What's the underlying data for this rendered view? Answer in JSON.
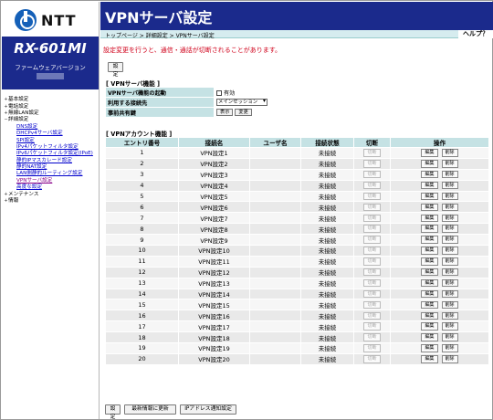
{
  "sidebar": {
    "logo_text": "NTT",
    "model": "RX-601MI",
    "firmware_label": "ファームウェアバージョン",
    "nav": [
      {
        "label": "基本設定",
        "level": 0,
        "toggle": "+"
      },
      {
        "label": "電話設定",
        "level": 0,
        "toggle": "+"
      },
      {
        "label": "無線LAN設定",
        "level": 0,
        "toggle": "+"
      },
      {
        "label": "詳細設定",
        "level": 0,
        "toggle": "−"
      },
      {
        "label": "DNS設定",
        "level": 1
      },
      {
        "label": "DHCPv4サーバ設定",
        "level": 1
      },
      {
        "label": "SPI設定",
        "level": 1
      },
      {
        "label": "IPv4パケットフィルタ設定",
        "level": 1
      },
      {
        "label": "IPv6パケットフィルタ設定(IPoE)",
        "level": 1
      },
      {
        "label": "静的IPマスカレード設定",
        "level": 1
      },
      {
        "label": "静的NAT設定",
        "level": 1
      },
      {
        "label": "LAN側静的ルーティング設定",
        "level": 1
      },
      {
        "label": "VPNサーバ設定",
        "level": 1,
        "active": true
      },
      {
        "label": "高度な設定",
        "level": 1
      },
      {
        "label": "メンテナンス",
        "level": 0,
        "toggle": "+"
      },
      {
        "label": "情報",
        "level": 0,
        "toggle": "+"
      }
    ]
  },
  "header": {
    "title": "VPNサーバ設定",
    "breadcrumb": "トップページ > 詳細設定 > VPNサーバ設定",
    "help": "ヘルプ？"
  },
  "warning": "設定変更を行うと、通信・通話が切断されることがあります。",
  "buttons": {
    "set": "設定",
    "refresh": "最新情報に更新",
    "ipv6_notify": "IPアドレス通知設定"
  },
  "vpn_function": {
    "title": "[ VPNサーバ機能 ]",
    "rows": [
      {
        "key": "VPNサーバ機能の起動",
        "value": "有効"
      },
      {
        "key": "利用する接続先",
        "value": "メインセッション"
      },
      {
        "key": "事前共有鍵",
        "show": "表示",
        "change": "変更"
      }
    ]
  },
  "accounts": {
    "title": "[ VPNアカウント機能 ]",
    "headers": [
      "エントリ番号",
      "接続名",
      "ユーザ名",
      "接続状態",
      "切断",
      "操作"
    ],
    "edit_label": "編集",
    "delete_label": "削除",
    "disconnect_label": "切断",
    "rows": [
      {
        "no": "1",
        "name": "VPN設定1",
        "user": "",
        "status": "未接続"
      },
      {
        "no": "2",
        "name": "VPN設定2",
        "user": "",
        "status": "未接続"
      },
      {
        "no": "3",
        "name": "VPN設定3",
        "user": "",
        "status": "未接続"
      },
      {
        "no": "4",
        "name": "VPN設定4",
        "user": "",
        "status": "未接続"
      },
      {
        "no": "5",
        "name": "VPN設定5",
        "user": "",
        "status": "未接続"
      },
      {
        "no": "6",
        "name": "VPN設定6",
        "user": "",
        "status": "未接続"
      },
      {
        "no": "7",
        "name": "VPN設定7",
        "user": "",
        "status": "未接続"
      },
      {
        "no": "8",
        "name": "VPN設定8",
        "user": "",
        "status": "未接続"
      },
      {
        "no": "9",
        "name": "VPN設定9",
        "user": "",
        "status": "未接続"
      },
      {
        "no": "10",
        "name": "VPN設定10",
        "user": "",
        "status": "未接続"
      },
      {
        "no": "11",
        "name": "VPN設定11",
        "user": "",
        "status": "未接続"
      },
      {
        "no": "12",
        "name": "VPN設定12",
        "user": "",
        "status": "未接続"
      },
      {
        "no": "13",
        "name": "VPN設定13",
        "user": "",
        "status": "未接続"
      },
      {
        "no": "14",
        "name": "VPN設定14",
        "user": "",
        "status": "未接続"
      },
      {
        "no": "15",
        "name": "VPN設定15",
        "user": "",
        "status": "未接続"
      },
      {
        "no": "16",
        "name": "VPN設定16",
        "user": "",
        "status": "未接続"
      },
      {
        "no": "17",
        "name": "VPN設定17",
        "user": "",
        "status": "未接続"
      },
      {
        "no": "18",
        "name": "VPN設定18",
        "user": "",
        "status": "未接続"
      },
      {
        "no": "19",
        "name": "VPN設定19",
        "user": "",
        "status": "未接続"
      },
      {
        "no": "20",
        "name": "VPN設定20",
        "user": "",
        "status": "未接続"
      }
    ]
  },
  "colors": {
    "header_bg": "#1b2a8c",
    "crumb_bg": "#d6ecef",
    "table_header_bg": "#c5e2e4",
    "warning": "#d0021b"
  }
}
